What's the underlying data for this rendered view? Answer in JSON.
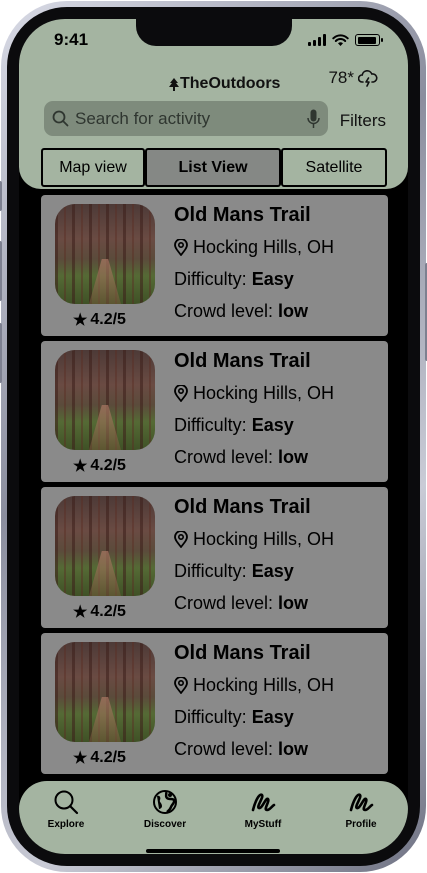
{
  "status_bar": {
    "time": "9:41",
    "battery_level": 0.9
  },
  "header": {
    "brand": "TheOutdoors",
    "weather": "78*",
    "search": {
      "placeholder": "Search for activity"
    },
    "filters_label": "Filters",
    "views": [
      {
        "label": "Map view",
        "active": false
      },
      {
        "label": "List View",
        "active": true
      },
      {
        "label": "Satellite",
        "active": false
      }
    ]
  },
  "trails": [
    {
      "name": "Old Mans Trail",
      "location": "Hocking Hills, OH",
      "difficulty_label": "Difficulty: ",
      "difficulty": "Easy",
      "crowd_label": "Crowd level: ",
      "crowd": "low",
      "rating": "4.2/5"
    },
    {
      "name": "Old Mans Trail",
      "location": "Hocking Hills, OH",
      "difficulty_label": "Difficulty: ",
      "difficulty": "Easy",
      "crowd_label": "Crowd level: ",
      "crowd": "low",
      "rating": "4.2/5"
    },
    {
      "name": "Old Mans Trail",
      "location": "Hocking Hills, OH",
      "difficulty_label": "Difficulty: ",
      "difficulty": "Easy",
      "crowd_label": "Crowd level: ",
      "crowd": "low",
      "rating": "4.2/5"
    },
    {
      "name": "Old Mans Trail",
      "location": "Hocking Hills, OH",
      "difficulty_label": "Difficulty: ",
      "difficulty": "Easy",
      "crowd_label": "Crowd level: ",
      "crowd": "low",
      "rating": "4.2/5"
    }
  ],
  "tabbar": [
    {
      "label": "Explore",
      "icon": "search-icon"
    },
    {
      "label": "Discover",
      "icon": "globe-icon"
    },
    {
      "label": "MyStuff",
      "icon": "scribble-icon"
    },
    {
      "label": "Profile",
      "icon": "scribble-icon"
    }
  ],
  "colors": {
    "header_bg": "#a4b4a1",
    "card_bg": "#8a8a8a",
    "active_segment": "#858885",
    "search_bg": "#7e8b7c"
  }
}
